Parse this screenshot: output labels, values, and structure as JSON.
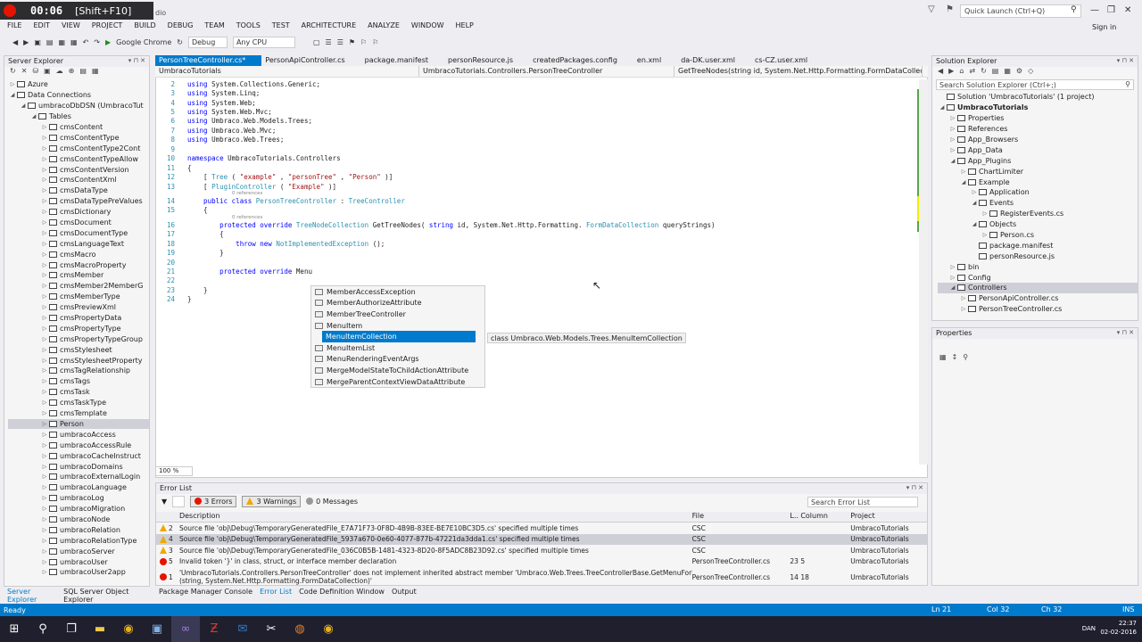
{
  "recorder": {
    "time": "00:06",
    "hint": "[Shift+F10]"
  },
  "title_suffix": "dio",
  "quick_launch": "Quick Launch (Ctrl+Q)",
  "menu": [
    "FILE",
    "EDIT",
    "VIEW",
    "PROJECT",
    "BUILD",
    "DEBUG",
    "TEAM",
    "TOOLS",
    "TEST",
    "ARCHITECTURE",
    "ANALYZE",
    "WINDOW",
    "HELP"
  ],
  "sign_in": "Sign in",
  "toolbar": {
    "browser": "Google Chrome",
    "config": "Debug",
    "platform": "Any CPU"
  },
  "server_explorer": {
    "title": "Server Explorer",
    "items": [
      {
        "label": "Azure",
        "level": 0,
        "arrow": "right"
      },
      {
        "label": "Data Connections",
        "level": 0,
        "arrow": "down"
      },
      {
        "label": "umbracoDbDSN (UmbracoTut",
        "level": 1,
        "arrow": "down"
      },
      {
        "label": "Tables",
        "level": 2,
        "arrow": "down"
      },
      {
        "label": "cmsContent",
        "level": 3,
        "arrow": "right"
      },
      {
        "label": "cmsContentType",
        "level": 3,
        "arrow": "right"
      },
      {
        "label": "cmsContentType2Cont",
        "level": 3,
        "arrow": "right"
      },
      {
        "label": "cmsContentTypeAllow",
        "level": 3,
        "arrow": "right"
      },
      {
        "label": "cmsContentVersion",
        "level": 3,
        "arrow": "right"
      },
      {
        "label": "cmsContentXml",
        "level": 3,
        "arrow": "right"
      },
      {
        "label": "cmsDataType",
        "level": 3,
        "arrow": "right"
      },
      {
        "label": "cmsDataTypePreValues",
        "level": 3,
        "arrow": "right"
      },
      {
        "label": "cmsDictionary",
        "level": 3,
        "arrow": "right"
      },
      {
        "label": "cmsDocument",
        "level": 3,
        "arrow": "right"
      },
      {
        "label": "cmsDocumentType",
        "level": 3,
        "arrow": "right"
      },
      {
        "label": "cmsLanguageText",
        "level": 3,
        "arrow": "right"
      },
      {
        "label": "cmsMacro",
        "level": 3,
        "arrow": "right"
      },
      {
        "label": "cmsMacroProperty",
        "level": 3,
        "arrow": "right"
      },
      {
        "label": "cmsMember",
        "level": 3,
        "arrow": "right"
      },
      {
        "label": "cmsMember2MemberG",
        "level": 3,
        "arrow": "right"
      },
      {
        "label": "cmsMemberType",
        "level": 3,
        "arrow": "right"
      },
      {
        "label": "cmsPreviewXml",
        "level": 3,
        "arrow": "right"
      },
      {
        "label": "cmsPropertyData",
        "level": 3,
        "arrow": "right"
      },
      {
        "label": "cmsPropertyType",
        "level": 3,
        "arrow": "right"
      },
      {
        "label": "cmsPropertyTypeGroup",
        "level": 3,
        "arrow": "right"
      },
      {
        "label": "cmsStylesheet",
        "level": 3,
        "arrow": "right"
      },
      {
        "label": "cmsStylesheetProperty",
        "level": 3,
        "arrow": "right"
      },
      {
        "label": "cmsTagRelationship",
        "level": 3,
        "arrow": "right"
      },
      {
        "label": "cmsTags",
        "level": 3,
        "arrow": "right"
      },
      {
        "label": "cmsTask",
        "level": 3,
        "arrow": "right"
      },
      {
        "label": "cmsTaskType",
        "level": 3,
        "arrow": "right"
      },
      {
        "label": "cmsTemplate",
        "level": 3,
        "arrow": "right"
      },
      {
        "label": "Person",
        "level": 3,
        "arrow": "right",
        "selected": true
      },
      {
        "label": "umbracoAccess",
        "level": 3,
        "arrow": "right"
      },
      {
        "label": "umbracoAccessRule",
        "level": 3,
        "arrow": "right"
      },
      {
        "label": "umbracoCacheInstruct",
        "level": 3,
        "arrow": "right"
      },
      {
        "label": "umbracoDomains",
        "level": 3,
        "arrow": "right"
      },
      {
        "label": "umbracoExternalLogin",
        "level": 3,
        "arrow": "right"
      },
      {
        "label": "umbracoLanguage",
        "level": 3,
        "arrow": "right"
      },
      {
        "label": "umbracoLog",
        "level": 3,
        "arrow": "right"
      },
      {
        "label": "umbracoMigration",
        "level": 3,
        "arrow": "right"
      },
      {
        "label": "umbracoNode",
        "level": 3,
        "arrow": "right"
      },
      {
        "label": "umbracoRelation",
        "level": 3,
        "arrow": "right"
      },
      {
        "label": "umbracoRelationType",
        "level": 3,
        "arrow": "right"
      },
      {
        "label": "umbracoServer",
        "level": 3,
        "arrow": "right"
      },
      {
        "label": "umbracoUser",
        "level": 3,
        "arrow": "right"
      },
      {
        "label": "umbracoUser2app",
        "level": 3,
        "arrow": "right"
      }
    ]
  },
  "tabs": [
    {
      "label": "PersonTreeController.cs*",
      "active": true
    },
    {
      "label": "PersonApiController.cs"
    },
    {
      "label": "package.manifest"
    },
    {
      "label": "personResource.js"
    },
    {
      "label": "createdPackages.config"
    },
    {
      "label": "en.xml"
    },
    {
      "label": "da-DK.user.xml"
    },
    {
      "label": "cs-CZ.user.xml"
    }
  ],
  "nav": {
    "project": "UmbracoTutorials",
    "class": "UmbracoTutorials.Controllers.PersonTreeController",
    "member": "GetTreeNodes(string id, System.Net.Http.Formatting.FormDataCollection q"
  },
  "code": [
    {
      "n": "2",
      "t": [
        [
          "kw",
          "using"
        ],
        [
          "",
          "System.Collections.Generic;"
        ]
      ]
    },
    {
      "n": "3",
      "t": [
        [
          "kw",
          "using"
        ],
        [
          "",
          "System.Linq;"
        ]
      ]
    },
    {
      "n": "4",
      "t": [
        [
          "kw",
          "using"
        ],
        [
          "",
          "System.Web;"
        ]
      ]
    },
    {
      "n": "5",
      "t": [
        [
          "kw",
          "using"
        ],
        [
          "",
          "System.Web.Mvc;"
        ]
      ]
    },
    {
      "n": "6",
      "t": [
        [
          "kw",
          "using"
        ],
        [
          "",
          "Umbraco.Web.Models.Trees;"
        ]
      ]
    },
    {
      "n": "7",
      "t": [
        [
          "kw",
          "using"
        ],
        [
          "",
          "Umbraco.Web.Mvc;"
        ]
      ]
    },
    {
      "n": "8",
      "t": [
        [
          "kw",
          "using"
        ],
        [
          "",
          "Umbraco.Web.Trees;"
        ]
      ]
    },
    {
      "n": "9",
      "t": []
    },
    {
      "n": "10",
      "t": [
        [
          "kw",
          "namespace"
        ],
        [
          "",
          "UmbracoTutorials.Controllers"
        ]
      ]
    },
    {
      "n": "11",
      "t": [
        [
          "",
          "{"
        ]
      ]
    },
    {
      "n": "12",
      "t": [
        [
          "",
          "    ["
        ],
        [
          "ty",
          "Tree"
        ],
        [
          "",
          "("
        ],
        [
          "st",
          "\"example\""
        ],
        [
          "",
          ","
        ],
        [
          "st",
          "\"personTree\""
        ],
        [
          "",
          ","
        ],
        [
          "st",
          "\"Person\""
        ],
        [
          "",
          ")]"
        ]
      ]
    },
    {
      "n": "13",
      "t": [
        [
          "",
          "    ["
        ],
        [
          "ty",
          "PluginController"
        ],
        [
          "",
          "("
        ],
        [
          "st",
          "\"Example\""
        ],
        [
          "",
          ")]"
        ]
      ]
    },
    {
      "ref": "0 references"
    },
    {
      "n": "14",
      "t": [
        [
          "kw",
          "    public class"
        ],
        [
          "ty",
          "PersonTreeController"
        ],
        [
          "",
          ":"
        ],
        [
          "ty",
          "TreeController"
        ]
      ]
    },
    {
      "n": "15",
      "t": [
        [
          "",
          "    {"
        ]
      ]
    },
    {
      "ref": "0 references"
    },
    {
      "n": "16",
      "t": [
        [
          "kw",
          "        protected override"
        ],
        [
          "ty",
          "TreeNodeCollection"
        ],
        [
          "",
          "GetTreeNodes("
        ],
        [
          "kw",
          "string"
        ],
        [
          "",
          "id, System.Net.Http.Formatting."
        ],
        [
          "ty",
          "FormDataCollection"
        ],
        [
          "",
          "queryStrings)"
        ]
      ]
    },
    {
      "n": "17",
      "t": [
        [
          "",
          "        {"
        ]
      ]
    },
    {
      "n": "18",
      "t": [
        [
          "kw",
          "            throw new"
        ],
        [
          "ty",
          "NotImplementedException"
        ],
        [
          "",
          "();"
        ]
      ]
    },
    {
      "n": "19",
      "t": [
        [
          "",
          "        }"
        ]
      ]
    },
    {
      "n": "20",
      "t": []
    },
    {
      "n": "21",
      "t": [
        [
          "kw",
          "        protected override"
        ],
        [
          "",
          "Menu"
        ]
      ]
    },
    {
      "n": "22",
      "t": []
    },
    {
      "n": "23",
      "t": [
        [
          "",
          "    }"
        ]
      ]
    },
    {
      "n": "24",
      "t": [
        [
          "",
          "}"
        ]
      ]
    }
  ],
  "completion": {
    "items": [
      "MemberAccessException",
      "MemberAuthorizeAttribute",
      "MemberTreeController",
      "MenuItem",
      "MenuItemCollection",
      "MenuItemList",
      "MenuRenderingEventArgs",
      "MergeModelStateToChildActionAttribute",
      "MergeParentContextViewDataAttribute"
    ],
    "selected_index": 4,
    "tooltip": "class Umbraco.Web.Models.Trees.MenuItemCollection"
  },
  "zoom": "100 %",
  "error_list": {
    "title": "Error List",
    "errors": "3 Errors",
    "warnings": "3 Warnings",
    "messages": "0 Messages",
    "search": "Search Error List",
    "headers": {
      "description": "Description",
      "file": "File",
      "line": "L..",
      "column": "Column",
      "project": "Project"
    },
    "rows": [
      {
        "kind": "warn",
        "num": "2",
        "desc": "Source file 'obj\\Debug\\TemporaryGeneratedFile_E7A71F73-0F8D-4B9B-83EE-BE7E10BC3D5.cs' specified multiple times",
        "file": "CSC",
        "line": "",
        "col": "",
        "project": "UmbracoTutorials"
      },
      {
        "kind": "warn",
        "num": "4",
        "desc": "Source file 'obj\\Debug\\TemporaryGeneratedFile_5937a670-0e60-4077-877b-47221da3dda1.cs' specified multiple times",
        "file": "CSC",
        "line": "",
        "col": "",
        "project": "UmbracoTutorials",
        "selected": true
      },
      {
        "kind": "warn",
        "num": "3",
        "desc": "Source file 'obj\\Debug\\TemporaryGeneratedFile_036C0B5B-1481-4323-8D20-8F5ADC8B23D92.cs' specified multiple times",
        "file": "CSC",
        "line": "",
        "col": "",
        "project": "UmbracoTutorials"
      },
      {
        "kind": "err",
        "num": "5",
        "desc": "Invalid token '}' in class, struct, or interface member declaration",
        "file": "PersonTreeController.cs",
        "line": "23",
        "col": "5",
        "project": "UmbracoTutorials"
      },
      {
        "kind": "err",
        "num": "1",
        "desc": "'UmbracoTutorials.Controllers.PersonTreeController' does not implement inherited abstract member 'Umbraco.Web.Trees.TreeControllerBase.GetMenuForNode",
        "desc2": "(string, System.Net.Http.Formatting.FormDataCollection)'",
        "file": "PersonTreeController.cs",
        "line": "14",
        "col": "18",
        "project": "UmbracoTutorials"
      }
    ]
  },
  "bottom_tabs": [
    "Package Manager Console",
    "Error List",
    "Code Definition Window",
    "Output"
  ],
  "left_bottom_tabs": [
    "Server Explorer",
    "SQL Server Object Explorer"
  ],
  "solution_explorer": {
    "title": "Solution Explorer",
    "search": "Search Solution Explorer (Ctrl+;)",
    "items": [
      {
        "label": "Solution 'UmbracoTutorials' (1 project)",
        "level": 0,
        "arrow": ""
      },
      {
        "label": "UmbracoTutorials",
        "level": 0,
        "arrow": "down",
        "bold": true
      },
      {
        "label": "Properties",
        "level": 1,
        "arrow": "right"
      },
      {
        "label": "References",
        "level": 1,
        "arrow": "right"
      },
      {
        "label": "App_Browsers",
        "level": 1,
        "arrow": "right"
      },
      {
        "label": "App_Data",
        "level": 1,
        "arrow": "right"
      },
      {
        "label": "App_Plugins",
        "level": 1,
        "arrow": "down"
      },
      {
        "label": "ChartLimiter",
        "level": 2,
        "arrow": "right"
      },
      {
        "label": "Example",
        "level": 2,
        "arrow": "down"
      },
      {
        "label": "Application",
        "level": 3,
        "arrow": "right"
      },
      {
        "label": "Events",
        "level": 3,
        "arrow": "down"
      },
      {
        "label": "RegisterEvents.cs",
        "level": 4,
        "arrow": "right"
      },
      {
        "label": "Objects",
        "level": 3,
        "arrow": "down"
      },
      {
        "label": "Person.cs",
        "level": 4,
        "arrow": "right"
      },
      {
        "label": "package.manifest",
        "level": 3,
        "arrow": ""
      },
      {
        "label": "personResource.js",
        "level": 3,
        "arrow": ""
      },
      {
        "label": "bin",
        "level": 1,
        "arrow": "right"
      },
      {
        "label": "Config",
        "level": 1,
        "arrow": "right"
      },
      {
        "label": "Controllers",
        "level": 1,
        "arrow": "down",
        "selected": true
      },
      {
        "label": "PersonApiController.cs",
        "level": 2,
        "arrow": "right"
      },
      {
        "label": "PersonTreeController.cs",
        "level": 2,
        "arrow": "right"
      }
    ]
  },
  "properties": {
    "title": "Properties"
  },
  "status": {
    "text": "Ready",
    "ln": "Ln 21",
    "col": "Col 32",
    "ch": "Ch 32",
    "ins": "INS"
  },
  "tray": {
    "lang": "DAN",
    "time": "22:37",
    "date": "02-02-2016"
  }
}
